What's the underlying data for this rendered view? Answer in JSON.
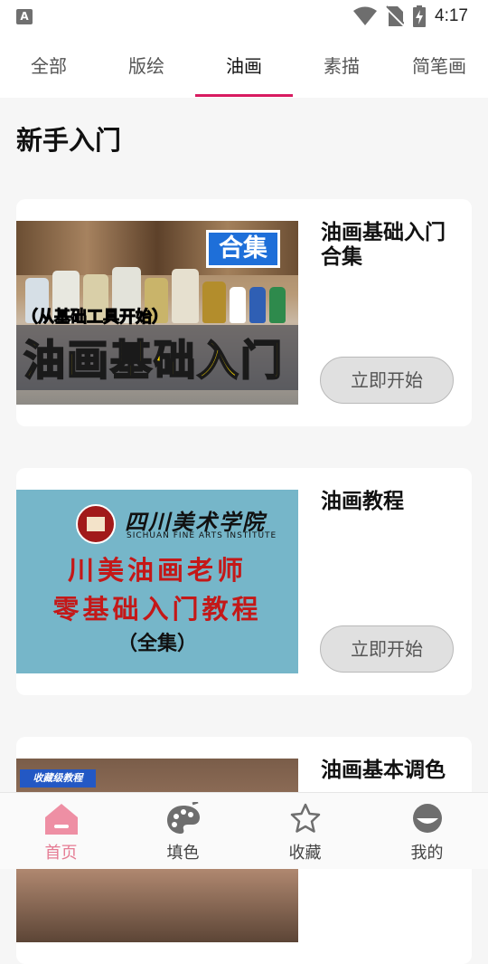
{
  "status_bar": {
    "time": "4:17",
    "app_icon_letter": "A"
  },
  "tabs": [
    {
      "label": "全部",
      "active": false
    },
    {
      "label": "版绘",
      "active": false
    },
    {
      "label": "油画",
      "active": true
    },
    {
      "label": "素描",
      "active": false
    },
    {
      "label": "简笔画",
      "active": false
    }
  ],
  "section": {
    "title": "新手入门"
  },
  "courses": [
    {
      "title": "油画基础入门合集",
      "button_label": "立即开始",
      "thumbnail": {
        "badge": "合集",
        "subtitle": "（从基础工具开始）",
        "headline": "油画基础入门"
      }
    },
    {
      "title": "油画教程",
      "button_label": "立即开始",
      "thumbnail": {
        "school_name": "四川美术学院",
        "school_name_en": "SICHUAN FINE ARTS INSTITUTE",
        "line1": "川美油画老师",
        "line2": "零基础入门教程",
        "line3": "（全集）"
      }
    },
    {
      "title": "油画基本调色",
      "button_label": "",
      "thumbnail": {
        "tag": "收藏级教程"
      }
    }
  ],
  "bottom_nav": [
    {
      "label": "首页",
      "icon": "home-icon",
      "active": true
    },
    {
      "label": "填色",
      "icon": "palette-icon",
      "active": false
    },
    {
      "label": "收藏",
      "icon": "star-icon",
      "active": false
    },
    {
      "label": "我的",
      "icon": "profile-icon",
      "active": false
    }
  ],
  "colors": {
    "accent": "#d81b60",
    "nav_active": "#e57b93",
    "button_bg": "#e0e0e0"
  }
}
